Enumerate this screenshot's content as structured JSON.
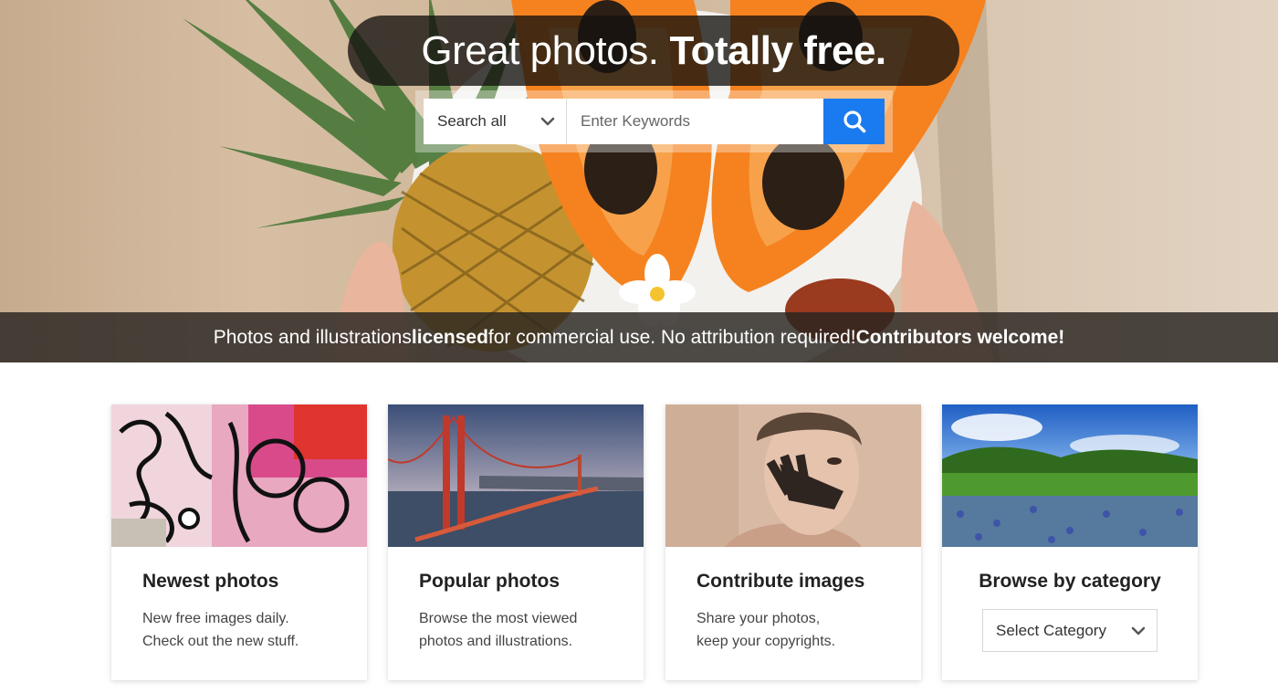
{
  "hero": {
    "headline_regular": "Great photos.",
    "headline_bold": "Totally free.",
    "search": {
      "scope_selected": "Search all",
      "placeholder": "Enter Keywords",
      "button_icon": "search-icon"
    },
    "band": {
      "part1": "Photos and illustrations ",
      "bold1": "licensed",
      "part2": " for commercial use. No attribution required! ",
      "bold2": "Contributors welcome!"
    }
  },
  "cards": [
    {
      "title": "Newest photos",
      "line1": "New free images daily.",
      "line2": "Check out the new stuff."
    },
    {
      "title": "Popular photos",
      "line1": "Browse the most viewed",
      "line2": "photos and illustrations."
    },
    {
      "title": "Contribute images",
      "line1": "Share your photos,",
      "line2": "keep your copyrights."
    },
    {
      "title": "Browse by category",
      "select_selected": "Select Category"
    }
  ],
  "colors": {
    "accent": "#1a7bf0",
    "headline_bg": "#141210",
    "band_bg": "#282421"
  }
}
